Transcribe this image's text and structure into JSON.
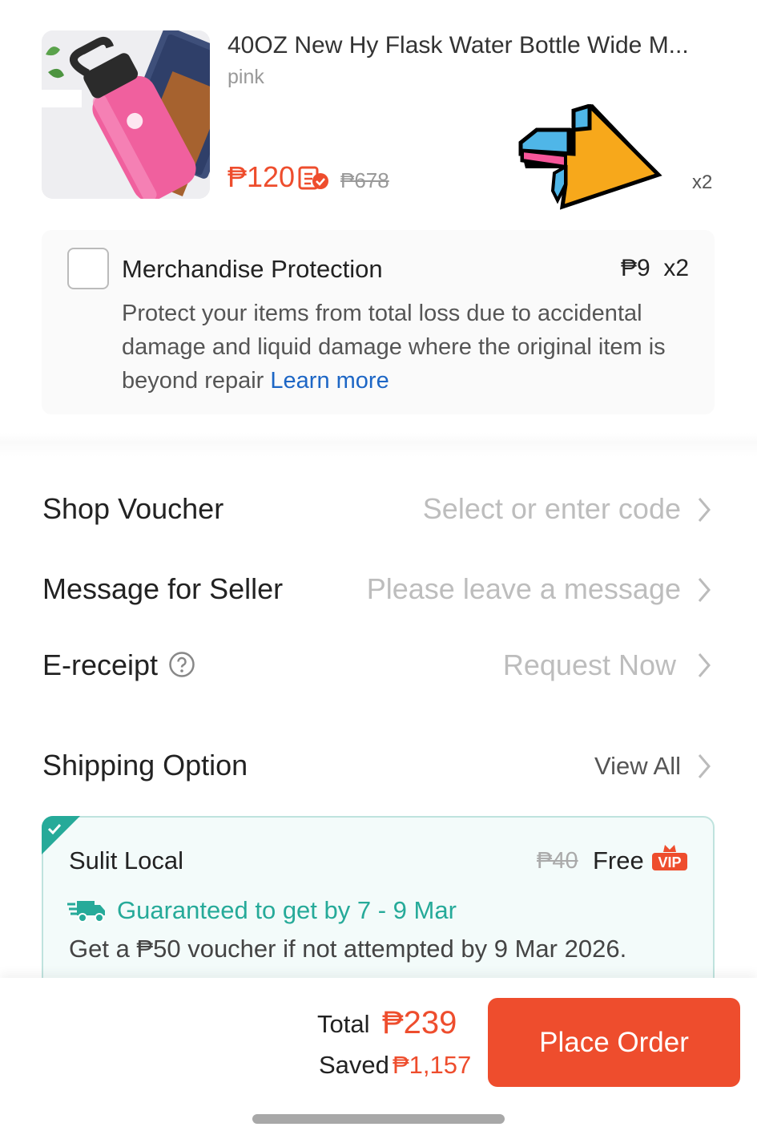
{
  "product": {
    "title": "40OZ New Hy Flask Water Bottle Wide M...",
    "variant": "pink",
    "price": "₱120",
    "original_price": "₱678",
    "quantity": "x2",
    "image": "pink-water-bottle-photo",
    "badge_icon": "coins-check-icon",
    "annotation_icon": "pointing-arrow-icon"
  },
  "protection": {
    "title": "Merchandise Protection",
    "price": "₱9  x2",
    "description": "Protect your items from total loss due to accidental damage and liquid damage where the original item is beyond repair ",
    "learn_more": "Learn more",
    "checked": false
  },
  "rows": {
    "shop_voucher": {
      "label": "Shop Voucher",
      "value": "Select or enter code"
    },
    "message": {
      "label": "Message for Seller",
      "value": "Please leave a message"
    },
    "ereceipt": {
      "label": "E-receipt",
      "value": "Request Now"
    }
  },
  "shipping": {
    "label": "Shipping Option",
    "view_all": "View All",
    "option": {
      "name": "Sulit Local",
      "old_fee": "₱40",
      "fee": "Free",
      "badge": "VIP",
      "guarantee": "Guaranteed to get by 7 - 9 Mar",
      "voucher_note": "Get a ₱50 voucher if not attempted by 9 Mar 2026.",
      "selected": true
    }
  },
  "footer": {
    "total_label": "Total",
    "total_value": "₱239",
    "saved_label": "Saved",
    "saved_value": "₱1,157",
    "place_order": "Place Order"
  },
  "colors": {
    "accent": "#ee4d2d",
    "link": "#1d66c5",
    "shipping_green": "#26aa99"
  }
}
